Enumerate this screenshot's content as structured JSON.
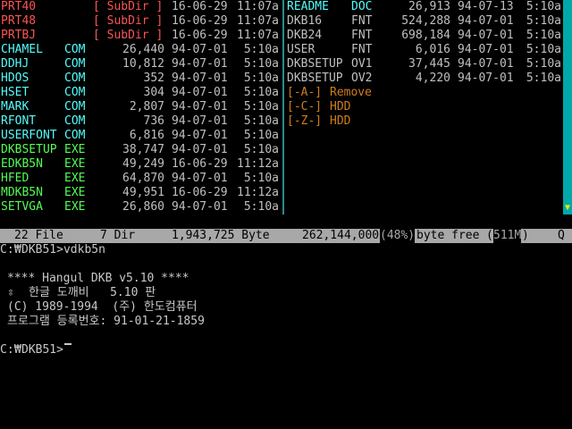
{
  "colors": {
    "red": "#fc5454",
    "cyan": "#54fcfc",
    "green": "#54fc54",
    "white": "#e8e8e8",
    "gray": "#c0c0c0",
    "orange": "#d07c1c",
    "status_bg": "#a8a8a8",
    "divider": "#2e8a8a"
  },
  "left_files": [
    {
      "name": "PRT40",
      "ext": "[ SubDir ]",
      "size": "",
      "date": "16-06-29",
      "time": "11:07a",
      "type": "dir"
    },
    {
      "name": "PRT48",
      "ext": "[ SubDir ]",
      "size": "",
      "date": "16-06-29",
      "time": "11:07a",
      "type": "dir"
    },
    {
      "name": "PRTBJ",
      "ext": "[ SubDir ]",
      "size": "",
      "date": "16-06-29",
      "time": "11:07a",
      "type": "dir"
    },
    {
      "name": "CHAMEL",
      "ext": "COM",
      "size": "26,440",
      "date": "94-07-01",
      "time": "5:10a",
      "type": "com"
    },
    {
      "name": "DDHJ",
      "ext": "COM",
      "size": "10,812",
      "date": "94-07-01",
      "time": "5:10a",
      "type": "com"
    },
    {
      "name": "HDOS",
      "ext": "COM",
      "size": "352",
      "date": "94-07-01",
      "time": "5:10a",
      "type": "com"
    },
    {
      "name": "HSET",
      "ext": "COM",
      "size": "304",
      "date": "94-07-01",
      "time": "5:10a",
      "type": "com"
    },
    {
      "name": "MARK",
      "ext": "COM",
      "size": "2,807",
      "date": "94-07-01",
      "time": "5:10a",
      "type": "com"
    },
    {
      "name": "RFONT",
      "ext": "COM",
      "size": "736",
      "date": "94-07-01",
      "time": "5:10a",
      "type": "com"
    },
    {
      "name": "USERFONT",
      "ext": "COM",
      "size": "6,816",
      "date": "94-07-01",
      "time": "5:10a",
      "type": "com"
    },
    {
      "name": "DKBSETUP",
      "ext": "EXE",
      "size": "38,747",
      "date": "94-07-01",
      "time": "5:10a",
      "type": "exe"
    },
    {
      "name": "EDKB5N",
      "ext": "EXE",
      "size": "49,249",
      "date": "16-06-29",
      "time": "11:12a",
      "type": "exe"
    },
    {
      "name": "HFED",
      "ext": "EXE",
      "size": "64,870",
      "date": "94-07-01",
      "time": "5:10a",
      "type": "exe"
    },
    {
      "name": "MDKB5N",
      "ext": "EXE",
      "size": "49,951",
      "date": "16-06-29",
      "time": "11:12a",
      "type": "exe"
    },
    {
      "name": "SETVGA",
      "ext": "EXE",
      "size": "26,860",
      "date": "94-07-01",
      "time": "5:10a",
      "type": "exe"
    }
  ],
  "right_files": [
    {
      "name": "README",
      "ext": "DOC",
      "size": "26,913",
      "date": "94-07-13",
      "time": "5:10a",
      "type": "doc"
    },
    {
      "name": "DKB16",
      "ext": "FNT",
      "size": "524,288",
      "date": "94-07-01",
      "time": "5:10a",
      "type": "plain"
    },
    {
      "name": "DKB24",
      "ext": "FNT",
      "size": "698,184",
      "date": "94-07-01",
      "time": "5:10a",
      "type": "plain"
    },
    {
      "name": "USER",
      "ext": "FNT",
      "size": "6,016",
      "date": "94-07-01",
      "time": "5:10a",
      "type": "plain"
    },
    {
      "name": "DKBSETUP",
      "ext": "OV1",
      "size": "37,445",
      "date": "94-07-01",
      "time": "5:10a",
      "type": "plain"
    },
    {
      "name": "DKBSETUP",
      "ext": "OV2",
      "size": "4,220",
      "date": "94-07-01",
      "time": "5:10a",
      "type": "plain"
    }
  ],
  "drives": [
    {
      "key": "[-A-]",
      "label": "Remove"
    },
    {
      "key": "[-C-]",
      "label": "HDD"
    },
    {
      "key": "[-Z-]",
      "label": "HDD"
    }
  ],
  "status": {
    "files": "22 File",
    "dirs": "7 Dir",
    "bytes": "1,943,725 Byte",
    "free_bytes": "262,144,000",
    "free_pct": "(48%)",
    "free_label": "byte free",
    "total_open": "(",
    "total": "511M",
    "total_close": ")",
    "key": "Q"
  },
  "console": {
    "prompt1_a": "C:",
    "prompt1_b": "DKB51>vdkb5n",
    "banner": "**** Hangul DKB v5.10 ****",
    "title_line": "한글 도깨비   5.10 판",
    "copyright": "(C) 1989-1994  (주) 한도컴퓨터",
    "reg": "프로그램 등록번호: 91-01-21-1859",
    "prompt2_a": "C:",
    "prompt2_b": "DKB51>"
  }
}
